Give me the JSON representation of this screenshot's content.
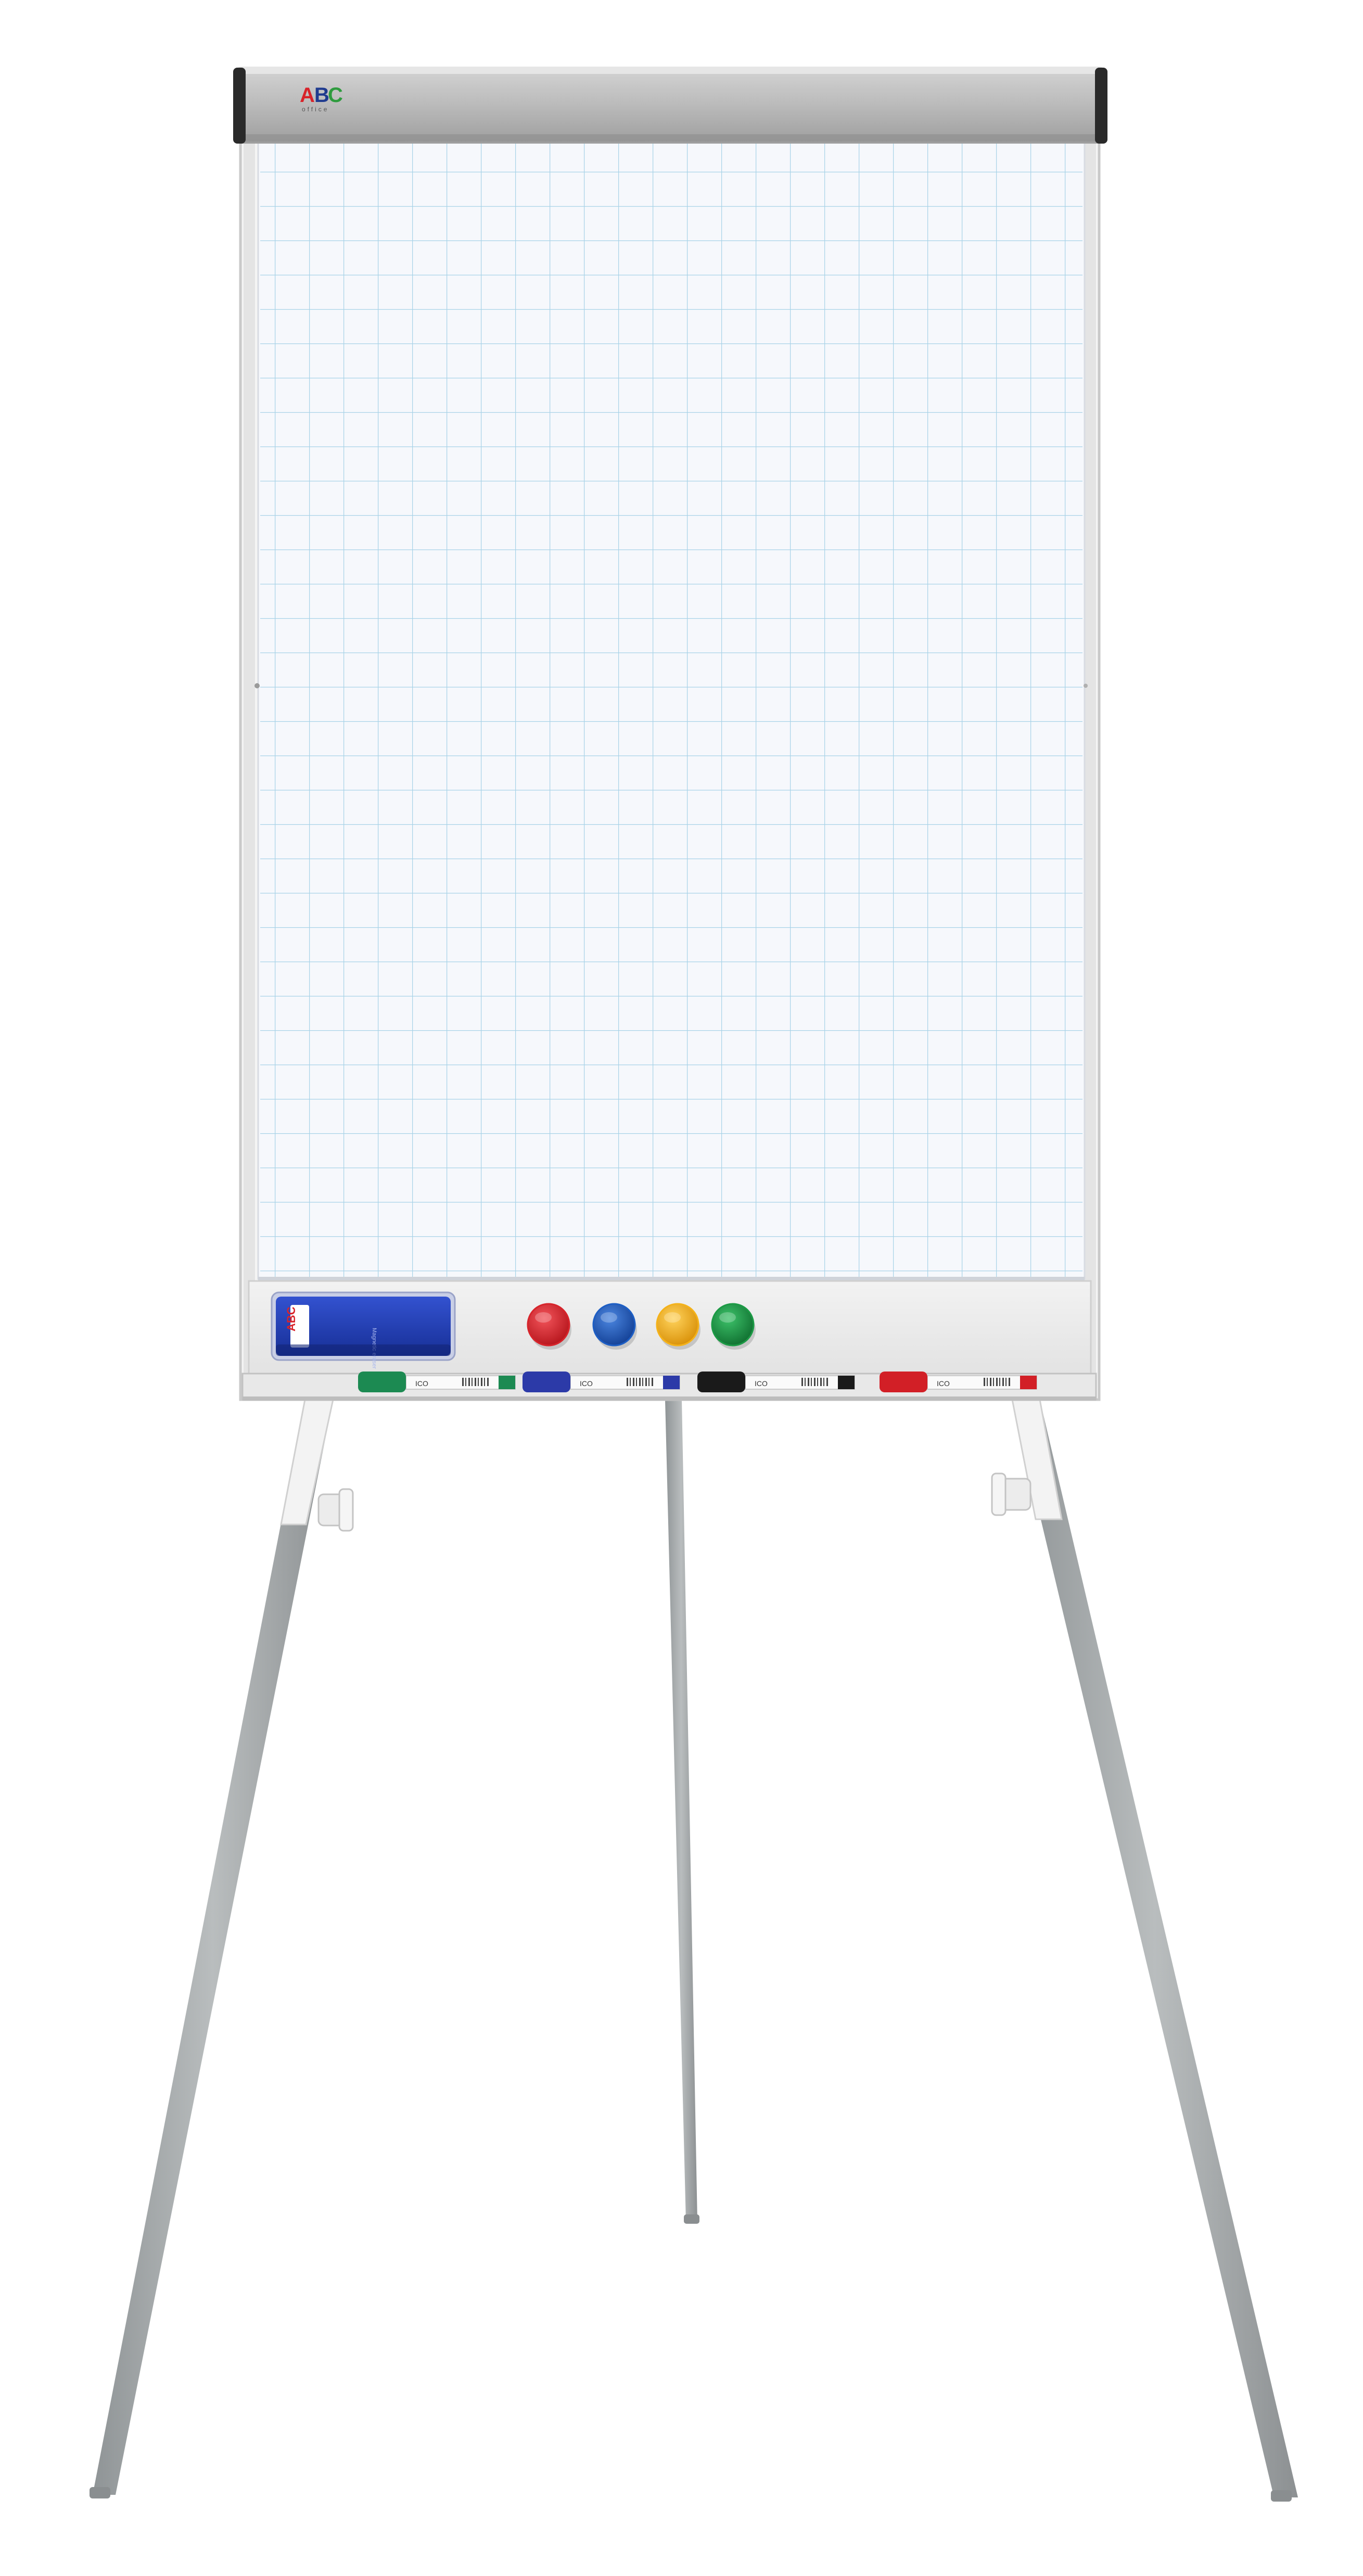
{
  "flipchart": {
    "brand_logo": {
      "letters": [
        "A",
        "B",
        "C"
      ],
      "letter_colors": [
        "#d8232a",
        "#1f3b8f",
        "#2e9b3e"
      ],
      "tagline": "office"
    },
    "paper": {
      "grid_color": "#a9d3e8",
      "background": "#f6f8fc"
    },
    "header_bar_color": "#b5b5b5",
    "frame_color": "#dcdcdc"
  },
  "tray": {
    "eraser": {
      "color": "#1f3fb0",
      "label_letters": [
        "A",
        "B",
        "C"
      ],
      "side_text": "Magnetic eraser"
    },
    "magnets": [
      {
        "name": "red",
        "color": "#d7242b"
      },
      {
        "name": "blue",
        "color": "#1d5ec4"
      },
      {
        "name": "yellow",
        "color": "#f4b21a"
      },
      {
        "name": "green",
        "color": "#1c9a45"
      }
    ],
    "markers": [
      {
        "name": "green",
        "cap_color": "#1c8a52",
        "brand": "ICO"
      },
      {
        "name": "blue",
        "cap_color": "#2c3aa8",
        "brand": "ICO"
      },
      {
        "name": "black",
        "cap_color": "#1a1a1a",
        "brand": "ICO"
      },
      {
        "name": "red",
        "cap_color": "#d21f26",
        "brand": "ICO"
      }
    ]
  },
  "stand": {
    "leg_color": "#a9adae",
    "clamp_color": "#e8e8e8"
  }
}
